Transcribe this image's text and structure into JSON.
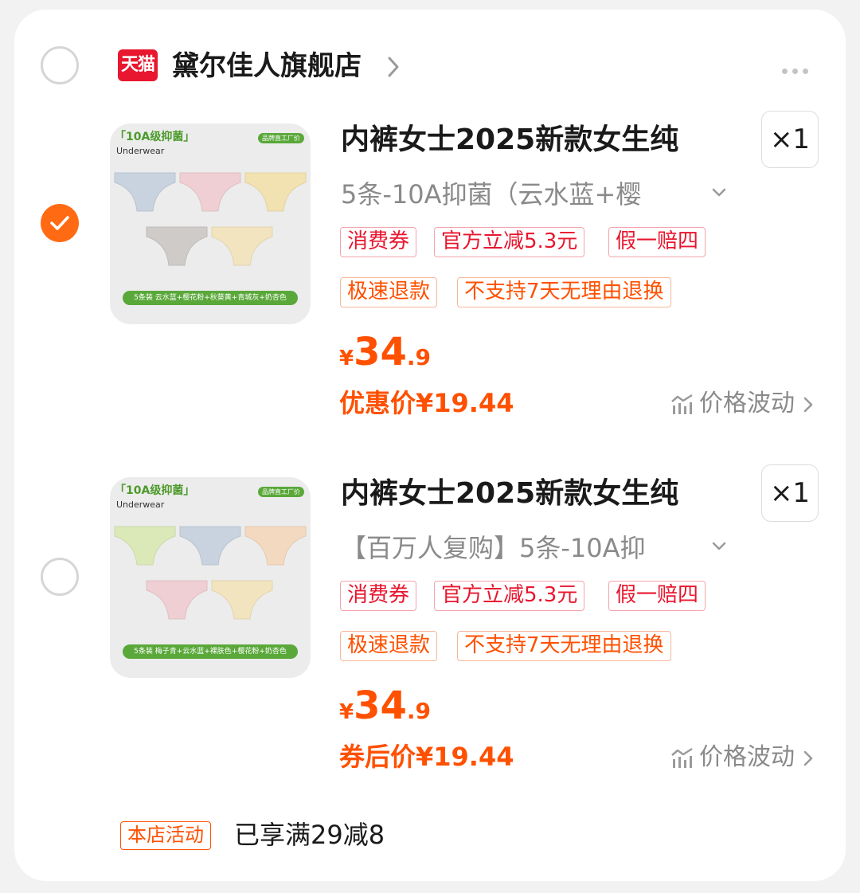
{
  "shop": {
    "logo_text": "天猫",
    "name": "黛尔佳人旗舰店"
  },
  "items": [
    {
      "selected": true,
      "thumb": {
        "badge": "「10A级抑菌」",
        "sub": "Underwear",
        "factory": "品牌直工厂价",
        "colors_bar": "5条装 云水蓝+樱花粉+秋葵黄+青城灰+奶杏色",
        "swatches": [
          "#c9d3df",
          "#efcfd4",
          "#f2e2b2",
          "#cfcbc8",
          "#f2e4bf"
        ]
      },
      "title": "内裤女士2025新款女生纯",
      "qty": "×1",
      "sku": "5条-10A抑菌（云水蓝+樱",
      "tags_row1": [
        "消费券",
        "官方立减5.3元",
        "假一赔四"
      ],
      "tags_row2": [
        "极速退款",
        "不支持7天无理由退换"
      ],
      "price": {
        "currency": "¥",
        "integer": "34",
        "decimal": ".9"
      },
      "discount_text": "优惠价¥19.44",
      "trend_label": "价格波动"
    },
    {
      "selected": false,
      "thumb": {
        "badge": "「10A级抑菌」",
        "sub": "Underwear",
        "factory": "品牌直工厂价",
        "colors_bar": "5条装 梅子青+云水蓝+裸肤色+樱花粉+奶杏色",
        "swatches": [
          "#dbe9b8",
          "#c9d3df",
          "#f4d9c1",
          "#efcfd4",
          "#f2e4bf"
        ]
      },
      "title": "内裤女士2025新款女生纯",
      "qty": "×1",
      "sku": "【百万人复购】5条-10A抑",
      "tags_row1": [
        "消费券",
        "官方立减5.3元",
        "假一赔四"
      ],
      "tags_row2": [
        "极速退款",
        "不支持7天无理由退换"
      ],
      "price": {
        "currency": "¥",
        "integer": "34",
        "decimal": ".9"
      },
      "discount_text": "券后价¥19.44",
      "trend_label": "价格波动"
    }
  ],
  "promo": {
    "tag": "本店活动",
    "text": "已享满29减8"
  },
  "colors": {
    "accent": "#ff5000",
    "tag_red": "#e8162e",
    "check": "#ff6a13"
  }
}
